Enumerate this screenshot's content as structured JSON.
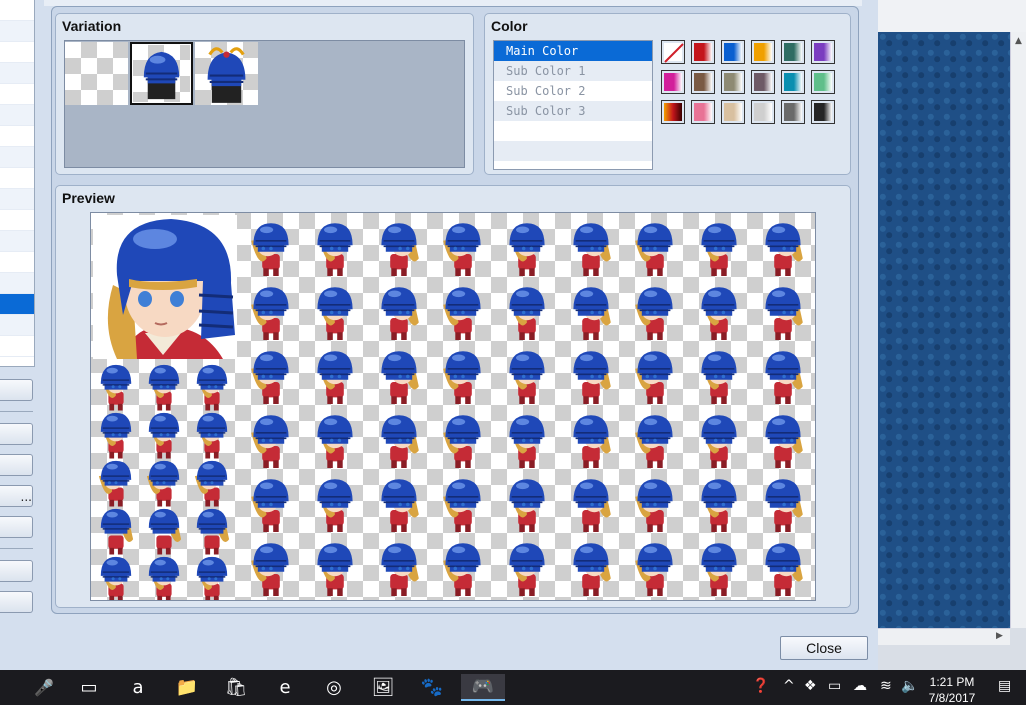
{
  "variation": {
    "title": "Variation",
    "thumbs": [
      {
        "name": "none"
      },
      {
        "name": "helmet-plain",
        "selected": true
      },
      {
        "name": "helmet-crest"
      }
    ]
  },
  "color": {
    "title": "Color",
    "items": [
      "Main Color",
      "Sub Color 1",
      "Sub Color 2",
      "Sub Color 3"
    ],
    "selected_index": 0,
    "swatches": [
      [
        "none",
        "#c4161c",
        "#0a5fd0",
        "#f0a000",
        "#2f6d63",
        "#7b3dc0"
      ],
      [
        "#d21f9b",
        "#7a5a44",
        "#8e8a73",
        "#6e5a66",
        "#0a8fb0",
        "#5fbf8a"
      ],
      [
        "gradient-red",
        "#e87396",
        "#d8c0a0",
        "#cfcfcf",
        "#6a6a6a",
        "#252525"
      ]
    ]
  },
  "preview": {
    "title": "Preview",
    "left_rows": 5,
    "grid_rows": 6,
    "grid_cols": 9
  },
  "close_label": "Close",
  "left_buttons": {
    "ellipsis_label": "..."
  },
  "taskbar": {
    "time": "1:21 PM",
    "date": "7/8/2017"
  },
  "colors": {
    "helmet": "#1f48b8",
    "helmet_dark": "#132c78",
    "hair": "#d9a441",
    "outfit": "#c52b36"
  }
}
